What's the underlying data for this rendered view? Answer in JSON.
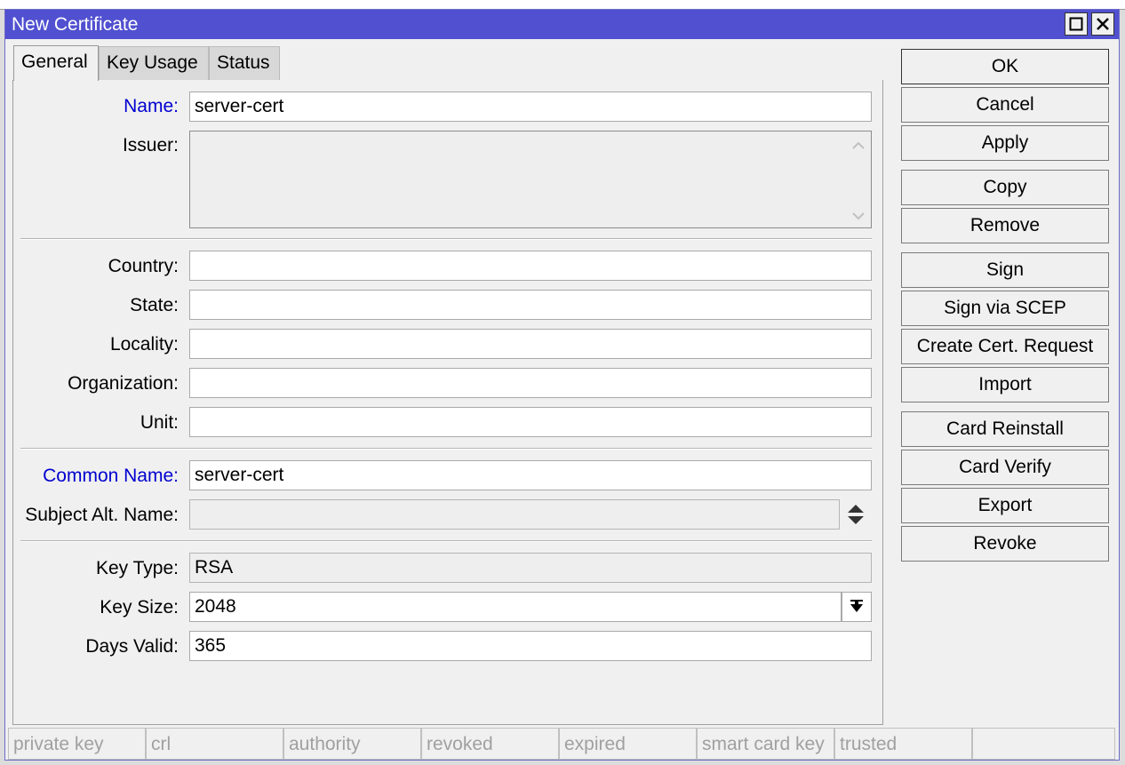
{
  "window": {
    "title": "New Certificate"
  },
  "tabs": [
    {
      "label": "General",
      "active": true
    },
    {
      "label": "Key Usage",
      "active": false
    },
    {
      "label": "Status",
      "active": false
    }
  ],
  "form": {
    "name": {
      "label": "Name:",
      "value": "server-cert"
    },
    "issuer": {
      "label": "Issuer:",
      "value": ""
    },
    "country": {
      "label": "Country:",
      "value": ""
    },
    "state": {
      "label": "State:",
      "value": ""
    },
    "locality": {
      "label": "Locality:",
      "value": ""
    },
    "organization": {
      "label": "Organization:",
      "value": ""
    },
    "unit": {
      "label": "Unit:",
      "value": ""
    },
    "common_name": {
      "label": "Common Name:",
      "value": "server-cert"
    },
    "subject_alt_name": {
      "label": "Subject Alt. Name:",
      "value": ""
    },
    "key_type": {
      "label": "Key Type:",
      "value": "RSA"
    },
    "key_size": {
      "label": "Key Size:",
      "value": "2048"
    },
    "days_valid": {
      "label": "Days Valid:",
      "value": "365"
    }
  },
  "buttons": {
    "ok": "OK",
    "cancel": "Cancel",
    "apply": "Apply",
    "copy": "Copy",
    "remove": "Remove",
    "sign": "Sign",
    "sign_scep": "Sign via SCEP",
    "create_request": "Create Cert. Request",
    "import": "Import",
    "card_reinstall": "Card Reinstall",
    "card_verify": "Card Verify",
    "export": "Export",
    "revoke": "Revoke"
  },
  "status_flags": [
    "private key",
    "crl",
    "authority",
    "revoked",
    "expired",
    "smart card key",
    "trusted",
    ""
  ],
  "colors": {
    "title_bar": "#5050d0",
    "required_label": "#0000d0"
  }
}
